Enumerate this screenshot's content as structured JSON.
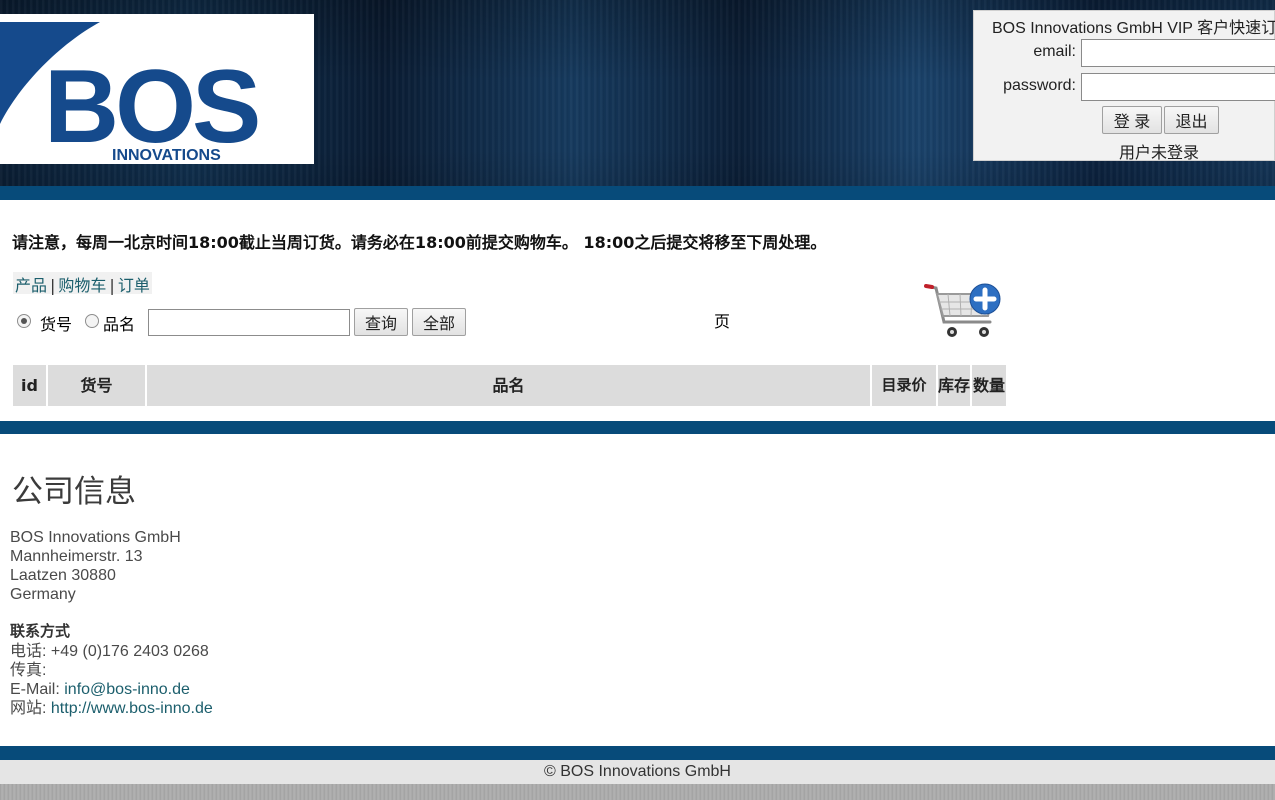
{
  "logo": {
    "brand": "BOS",
    "sub": "INNOVATIONS"
  },
  "login": {
    "title": "BOS Innovations GmbH VIP 客户快速订",
    "email_label": "email:",
    "password_label": "password:",
    "login_button": "登 录",
    "logout_button": "退出",
    "status": "用户未登录"
  },
  "notice": "请注意，每周一北京时间18:00截止当周订货。请务必在18:00前提交购物车。 18:00之后提交将移至下周处理。",
  "nav": {
    "products": "产品",
    "cart": "购物车",
    "orders": "订单",
    "sep": "|"
  },
  "search": {
    "radio_item_no": "货号",
    "radio_name": "品名",
    "query_button": "查询",
    "all_button": "全部",
    "selected": "货号"
  },
  "page_label": "页",
  "table": {
    "headers": {
      "id": "id",
      "item_no": "货号",
      "name": "品名",
      "price": "目录价",
      "stock": "库存",
      "qty": "数量"
    }
  },
  "company": {
    "title": "公司信息",
    "name": "BOS Innovations GmbH",
    "street": "Mannheimerstr. 13",
    "city": "Laatzen 30880",
    "country": "Germany",
    "contact_heading": "联系方式",
    "phone_label": "电话:",
    "phone": "+49 (0)176 2403 0268",
    "fax_label": "传真:",
    "email_label": "E-Mail:",
    "email": "info@bos-inno.de",
    "web_label": "网站:",
    "web": "http://www.bos-inno.de"
  },
  "footer": "© BOS Innovations GmbH",
  "colors": {
    "band": "#074b7a",
    "logo_blue": "#154a8c",
    "link": "#1b5e6c"
  }
}
